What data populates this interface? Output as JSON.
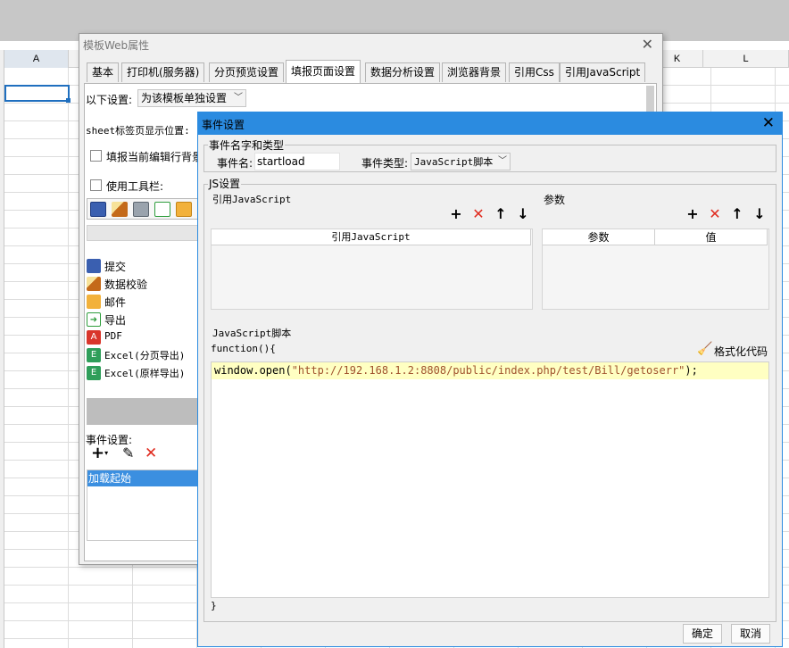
{
  "sheet": {
    "col_a": "A",
    "col_k": "K",
    "col_l": "L"
  },
  "dialog1": {
    "title": "模板Web属性",
    "tabs": [
      "基本",
      "打印机(服务器)",
      "分页预览设置",
      "填报页面设置",
      "数据分析设置",
      "浏览器背景",
      "引用Css",
      "引用JavaScript"
    ],
    "active_tab": "填报页面设置",
    "setting_label": "以下设置:",
    "setting_value": "为该模板单独设置",
    "sheet_tab_label": "sheet标签页显示位置:",
    "fill_bg_label": "填报当前编辑行背景",
    "toolbar_label": "使用工具栏:",
    "buttons": [
      {
        "icon": "submit-icon",
        "label": "提交"
      },
      {
        "icon": "validate-icon",
        "label": "数据校验"
      },
      {
        "icon": "mail-icon",
        "label": "邮件"
      },
      {
        "icon": "export-icon",
        "label": "导出"
      },
      {
        "icon": "pdf-icon",
        "label": "PDF"
      },
      {
        "icon": "excel-icon",
        "label": "Excel(分页导出)"
      },
      {
        "icon": "excel-icon",
        "label": "Excel(原样导出)"
      }
    ],
    "event_label": "事件设置:",
    "event_items": [
      "加载起始"
    ]
  },
  "dialog2": {
    "title": "事件设置",
    "name_type_group": "事件名字和类型",
    "event_name_label": "事件名:",
    "event_name_value": "startload",
    "event_type_label": "事件类型:",
    "event_type_value": "JavaScript脚本",
    "js_group": "JS设置",
    "ref_js_label": "引用JavaScript",
    "params_label": "参数",
    "ref_js_col": "引用JavaScript",
    "params_col": "参数",
    "value_col": "值",
    "script_label": "JavaScript脚本",
    "function_open": "function(){",
    "format_label": "格式化代码",
    "code_prefix": "window.open(",
    "code_string": "\"http://192.168.1.2:8808/public/index.php/test/Bill/getoserr\"",
    "code_suffix": ");",
    "function_close": "}",
    "ok_label": "确定",
    "cancel_label": "取消"
  }
}
